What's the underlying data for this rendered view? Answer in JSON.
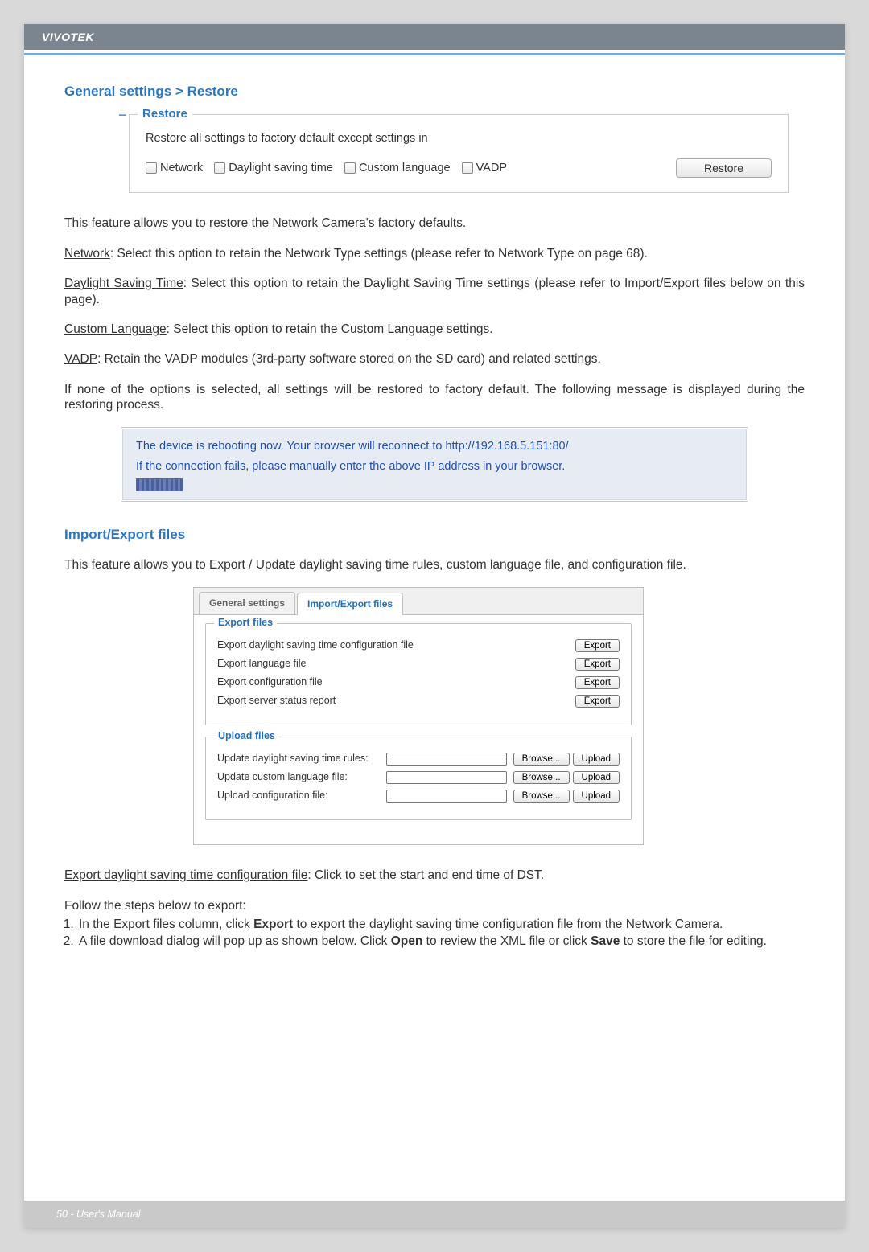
{
  "header": {
    "brand": "VIVOTEK"
  },
  "section1": {
    "title": "General settings > Restore",
    "legend": "Restore",
    "subtitle": "Restore all settings to factory default except settings in",
    "checkboxes": [
      "Network",
      "Daylight saving time",
      "Custom language",
      "VADP"
    ],
    "button": "Restore"
  },
  "body": {
    "p1": "This feature allows you to restore the Network Camera's factory defaults.",
    "p2a": "Network",
    "p2b": ": Select this option to retain the Network Type settings (please refer to Network Type on page 68).",
    "p3a": "Daylight Saving Time",
    "p3b": ": Select this option to retain the Daylight Saving Time settings (please refer to Import/Export files below on this page).",
    "p4a": "Custom Language",
    "p4b": ": Select this option to retain the Custom Language settings.",
    "p5a": "VADP",
    "p5b": ": Retain the VADP modules (3rd-party software stored on the SD card) and related settings.",
    "p6": "If none of the options is selected, all settings will be restored to factory default.  The following message is displayed during the restoring process."
  },
  "reboot": {
    "line1": "The device is rebooting now. Your browser will reconnect to http://192.168.5.151:80/",
    "line2": "If the connection fails, please manually enter the above IP address in your browser."
  },
  "section2": {
    "title": "Import/Export files",
    "intro": "This feature allows you to Export / Update daylight saving time rules, custom language file, and configuration file.",
    "tabs": [
      "General settings",
      "Import/Export files"
    ],
    "export_legend": "Export files",
    "export_rows": [
      "Export daylight saving time configuration file",
      "Export language file",
      "Export configuration file",
      "Export server status report"
    ],
    "export_btn": "Export",
    "upload_legend": "Upload files",
    "upload_rows": [
      "Update daylight saving time rules:",
      "Update custom language file:",
      "Upload configuration file:"
    ],
    "browse_btn": "Browse...",
    "upload_btn": "Upload"
  },
  "tail": {
    "p1a": "Export daylight saving time configuration file",
    "p1b": ": Click to set the start and end time of DST.",
    "p2": "Follow the steps below to export:",
    "step1a": "In the Export files column, click ",
    "step1b": "Export",
    "step1c": " to export the daylight saving time configuration file from the Network Camera.",
    "step2a": "A file download dialog will pop up as shown below. Click ",
    "step2b": "Open",
    "step2c": " to review the XML file or click ",
    "step2d": "Save",
    "step2e": " to store the file for editing."
  },
  "footer": {
    "text": "50 - User's Manual"
  }
}
